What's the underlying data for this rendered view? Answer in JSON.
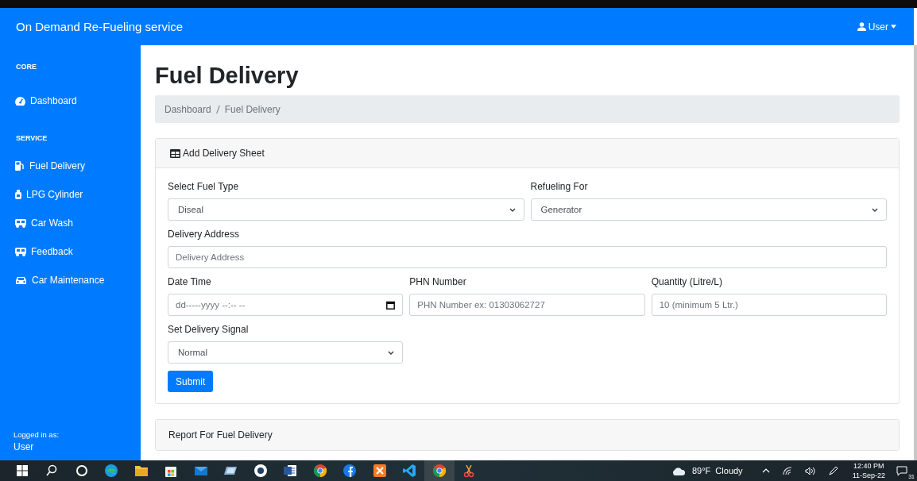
{
  "topbar": {
    "brand": "On Demand Re-Fueling service",
    "user_menu": "User"
  },
  "sidebar": {
    "sections": [
      {
        "heading": "CORE",
        "items": [
          {
            "label": "Dashboard",
            "kind": "gauge"
          }
        ]
      },
      {
        "heading": "SERVICE",
        "items": [
          {
            "label": "Fuel Delivery",
            "kind": "pump"
          },
          {
            "label": "LPG Cylinder",
            "kind": "cylinder"
          },
          {
            "label": "Car Wash",
            "kind": "van"
          },
          {
            "label": "Feedback",
            "kind": "van"
          },
          {
            "label": "Car Maintenance",
            "kind": "car"
          }
        ]
      }
    ],
    "footer": {
      "caption": "Logged in as:",
      "user": "User"
    }
  },
  "page": {
    "title": "Fuel Delivery",
    "breadcrumb": [
      "Dashboard",
      "Fuel Delivery"
    ],
    "form_card": {
      "header": "Add Delivery Sheet",
      "rows": [
        [
          {
            "kind": "select",
            "label": "Select Fuel Type",
            "value": "Diseal"
          },
          {
            "kind": "select",
            "label": "Refueling For",
            "value": "Generator"
          }
        ],
        [
          {
            "kind": "text",
            "label": "Delivery Address",
            "placeholder": "Delivery Address"
          }
        ],
        [
          {
            "kind": "datetime",
            "label": "Date Time",
            "placeholder": "dd-----yyyy --:-- --"
          },
          {
            "kind": "text",
            "label": "PHN Number",
            "placeholder": "PHN Number ex: 01303062727"
          },
          {
            "kind": "text",
            "label": "Quantity (Litre/L)",
            "placeholder": "10 (minimum 5 Ltr.)"
          }
        ],
        [
          {
            "kind": "select",
            "label": "Set Delivery Signal",
            "value": "Normal"
          }
        ]
      ],
      "submit": "Submit"
    },
    "report_card": {
      "header": "Report For Fuel Delivery"
    }
  },
  "taskbar": {
    "apps": [
      {
        "kind": "windows",
        "selected": false
      },
      {
        "kind": "search",
        "selected": false
      },
      {
        "kind": "ring",
        "selected": false
      },
      {
        "kind": "wave",
        "selected": false
      },
      {
        "kind": "folder",
        "selected": false
      },
      {
        "kind": "bag",
        "selected": false
      },
      {
        "kind": "mail",
        "selected": false
      },
      {
        "kind": "slab",
        "selected": false
      },
      {
        "kind": "disc",
        "selected": false
      },
      {
        "kind": "doc",
        "selected": false
      },
      {
        "kind": "chrome",
        "selected": false
      },
      {
        "kind": "fb",
        "selected": false
      },
      {
        "kind": "cross",
        "selected": false
      },
      {
        "kind": "code",
        "selected": false
      },
      {
        "kind": "chrome",
        "selected": true
      },
      {
        "kind": "scissors",
        "selected": false
      }
    ],
    "weather": "89°F  Cloudy",
    "time": "12:40 PM",
    "date": "11-Sep-22",
    "notifications": "31"
  }
}
